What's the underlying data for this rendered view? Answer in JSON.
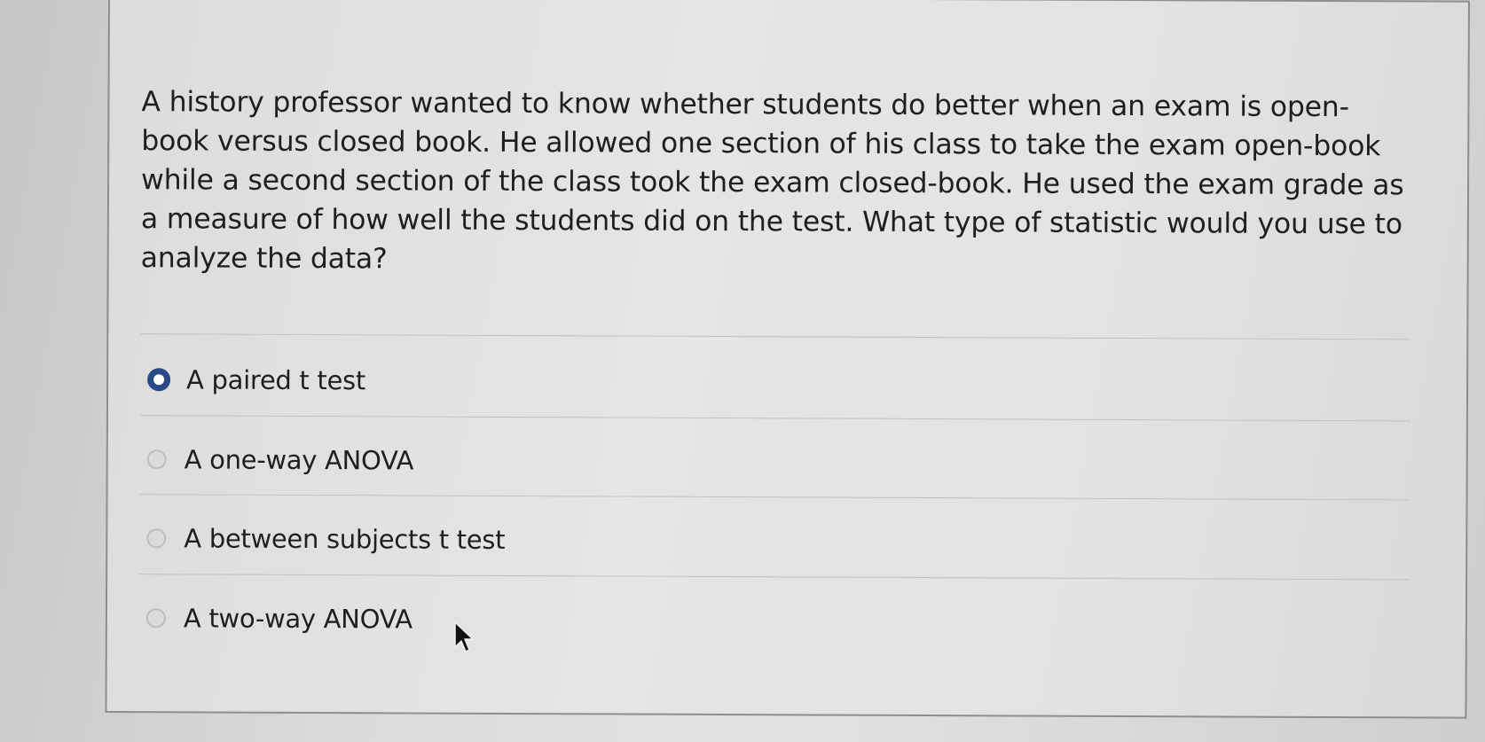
{
  "question": {
    "text": "A history professor wanted to know whether students do better when an exam is open-book versus closed book. He allowed one section of his class to take the exam open-book while a second section of the class took the exam closed-book. He used the exam grade as a measure of how well the students did on the test. What type of statistic would you use to analyze the data?"
  },
  "options": [
    {
      "label": "A paired t test",
      "selected": true
    },
    {
      "label": "A one-way ANOVA",
      "selected": false
    },
    {
      "label": "A between subjects t test",
      "selected": false
    },
    {
      "label": "A two-way ANOVA",
      "selected": false
    }
  ],
  "colors": {
    "radio_selected": "#2a4a86",
    "text": "#1f1f1f",
    "card_border": "#8f8e8c"
  },
  "icons": {
    "cursor": "mouse-pointer-icon",
    "radio_checked": "radio-checked-icon",
    "radio_unchecked": "radio-unchecked-icon"
  }
}
